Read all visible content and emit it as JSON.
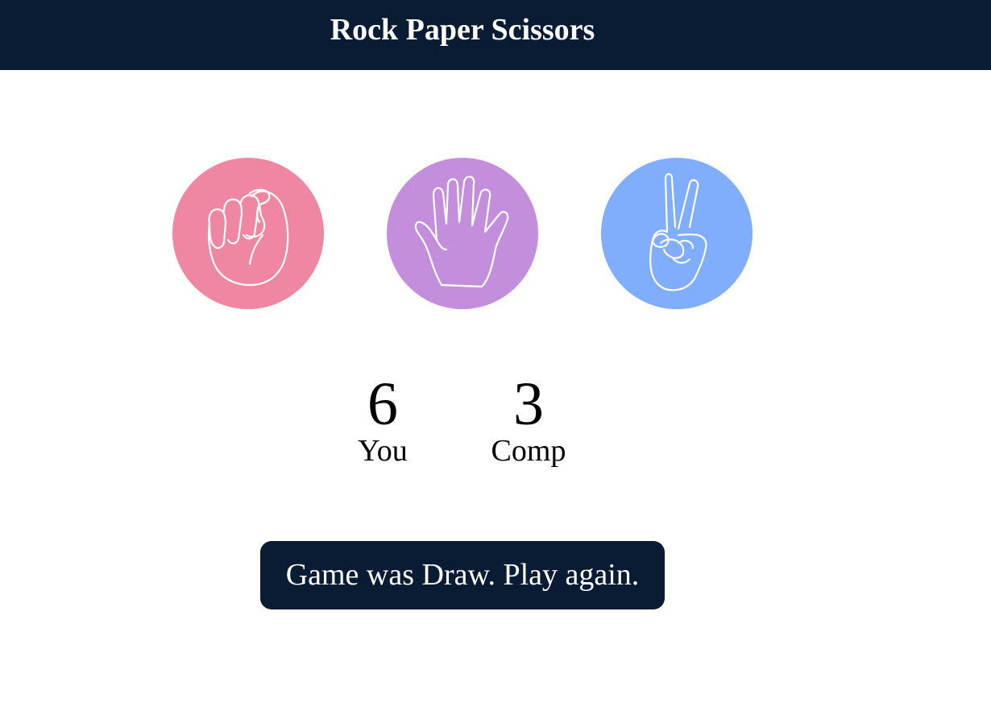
{
  "header": {
    "title": "Rock Paper Scissors"
  },
  "choices": [
    {
      "name": "rock",
      "icon": "fist-icon",
      "color": "#f087a2"
    },
    {
      "name": "paper",
      "icon": "open-hand-icon",
      "color": "#c38fdd"
    },
    {
      "name": "scissors",
      "icon": "peace-hand-icon",
      "color": "#80aefd"
    }
  ],
  "score": {
    "user": {
      "value": "6",
      "label": "You"
    },
    "comp": {
      "value": "3",
      "label": "Comp"
    }
  },
  "message": {
    "text": "Game was Draw. Play again.",
    "background": "#0a1c33"
  }
}
